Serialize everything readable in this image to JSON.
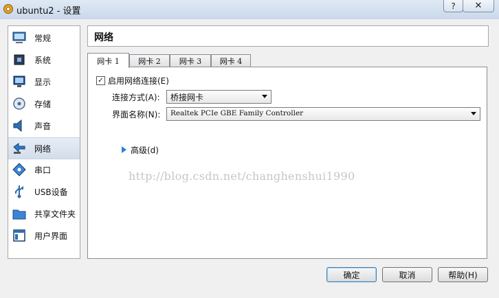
{
  "window": {
    "title": "ubuntu2 - 设置",
    "help_label": "?",
    "close_label": "✕"
  },
  "sidebar": {
    "items": [
      {
        "label": "常规",
        "icon": "monitor-icon"
      },
      {
        "label": "系统",
        "icon": "chip-icon"
      },
      {
        "label": "显示",
        "icon": "display-icon"
      },
      {
        "label": "存储",
        "icon": "disc-icon"
      },
      {
        "label": "声音",
        "icon": "speaker-icon"
      },
      {
        "label": "网络",
        "icon": "network-icon",
        "selected": true
      },
      {
        "label": "串口",
        "icon": "serial-port-icon"
      },
      {
        "label": "USB设备",
        "icon": "usb-icon"
      },
      {
        "label": "共享文件夹",
        "icon": "folder-icon"
      },
      {
        "label": "用户界面",
        "icon": "window-icon"
      }
    ]
  },
  "header": {
    "title": "网络"
  },
  "tabs": [
    {
      "label": "网卡 1",
      "active": true
    },
    {
      "label": "网卡 2"
    },
    {
      "label": "网卡 3"
    },
    {
      "label": "网卡 4"
    }
  ],
  "panel": {
    "enable_label": "启用网络连接(E)",
    "enable_checked": true,
    "attach_label": "连接方式(A):",
    "attach_value": "桥接网卡",
    "name_label": "界面名称(N):",
    "name_value": "Realtek PCIe GBE Family Controller",
    "advanced_label": "高级(d)"
  },
  "watermark": "http://blog.csdn.net/changhenshui1990",
  "buttons": {
    "ok": "确定",
    "cancel": "取消",
    "help": "帮助(H)"
  }
}
